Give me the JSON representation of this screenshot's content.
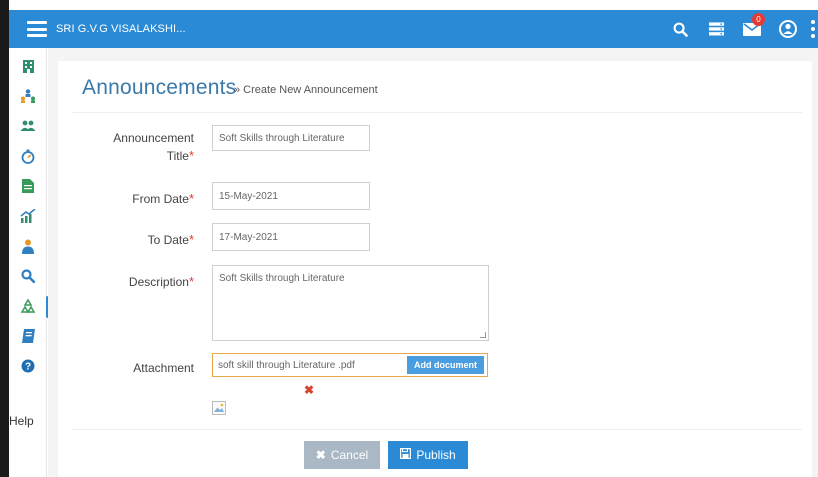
{
  "header": {
    "brand": "SRI G.V.G VISALAKSHI...",
    "notification_count": "0"
  },
  "sidebar": {
    "items": [
      "building-icon",
      "org-chart-icon",
      "users-icon",
      "stopwatch-icon",
      "document-icon",
      "chart-icon",
      "teacher-icon",
      "search-icon",
      "recycle-icon",
      "book-icon",
      "help-circle-icon"
    ],
    "help_label": "Help",
    "active_index": 8
  },
  "page": {
    "title": "Announcements",
    "subtitle": "» Create New Announcement"
  },
  "form": {
    "title_label_line1": "Announcement",
    "title_label_line2": "Title",
    "title_value": "Soft Skills through Literature",
    "from_label": "From Date",
    "from_value": "15-May-2021",
    "to_label": "To Date",
    "to_value": "17-May-2021",
    "description_label": "Description",
    "description_value": "Soft Skills through Literature",
    "attachment_label": "Attachment",
    "attachment_value": "soft skill through Literature .pdf",
    "add_document_label": "Add document",
    "required_mark": "*",
    "remove_mark": "✖"
  },
  "actions": {
    "cancel_label": "Cancel",
    "publish_label": "Publish"
  },
  "colors": {
    "topbar": "#2b8ad6",
    "accent": "#3a79a9",
    "required": "#e53935",
    "cancel": "#a9b8c4",
    "publish": "#2b8ad6"
  }
}
